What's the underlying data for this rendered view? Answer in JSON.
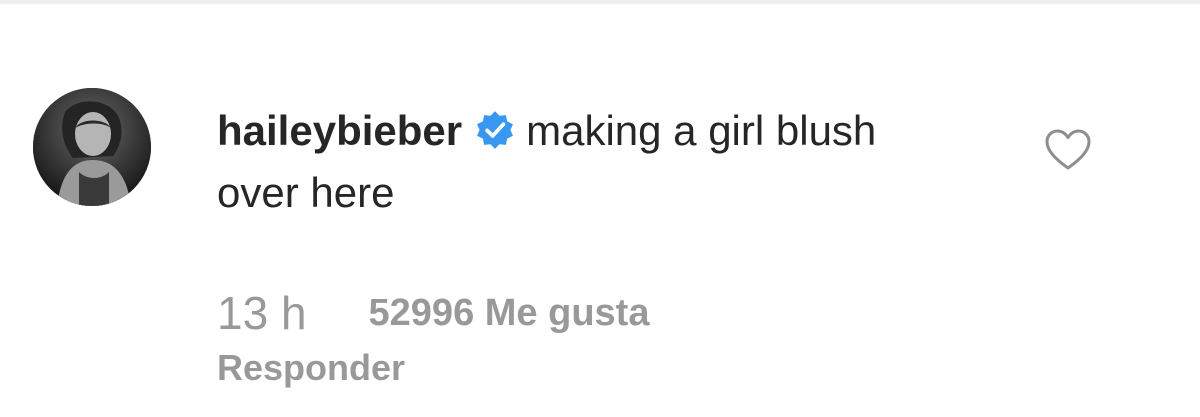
{
  "comment": {
    "username": "haileybieber",
    "verified": true,
    "verified_color": "#3897f0",
    "text": "making a girl blush over here",
    "timestamp": "13 h",
    "likes": "52996 Me gusta",
    "reply_label": "Responder"
  },
  "icons": {
    "avatar": "user-avatar-photo",
    "verified": "verified-badge-icon",
    "like": "heart-outline-icon"
  },
  "colors": {
    "text_primary": "#262626",
    "text_secondary": "#999999",
    "icon_stroke": "#8e8e8e"
  }
}
